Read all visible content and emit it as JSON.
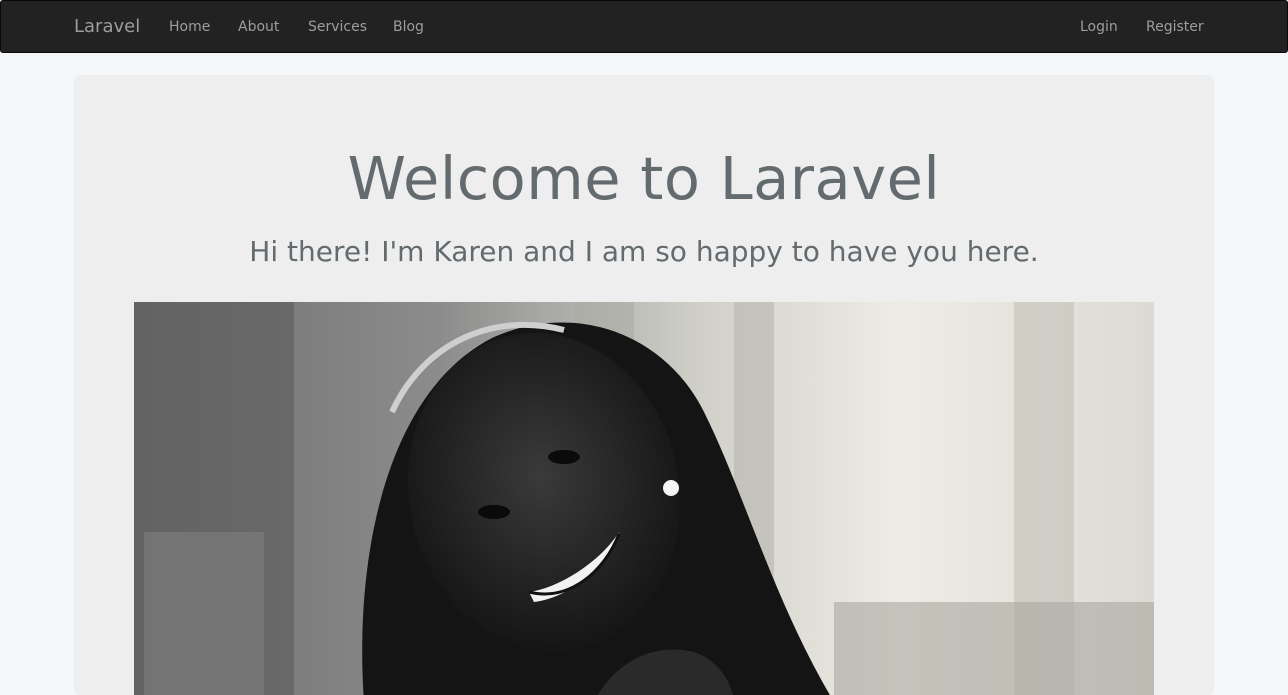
{
  "navbar": {
    "brand": "Laravel",
    "links": [
      "Home",
      "About",
      "Services",
      "Blog"
    ],
    "right_links": [
      "Login",
      "Register"
    ]
  },
  "jumbotron": {
    "title": "Welcome to Laravel",
    "lead": "Hi there! I'm Karen and I am so happy to have you here."
  },
  "colors": {
    "navbar_bg": "#222222",
    "nav_text": "#9d9d9d",
    "jumbotron_bg": "#eeeeee",
    "heading_text": "#636b6f",
    "page_bg": "#f4f7fa"
  }
}
